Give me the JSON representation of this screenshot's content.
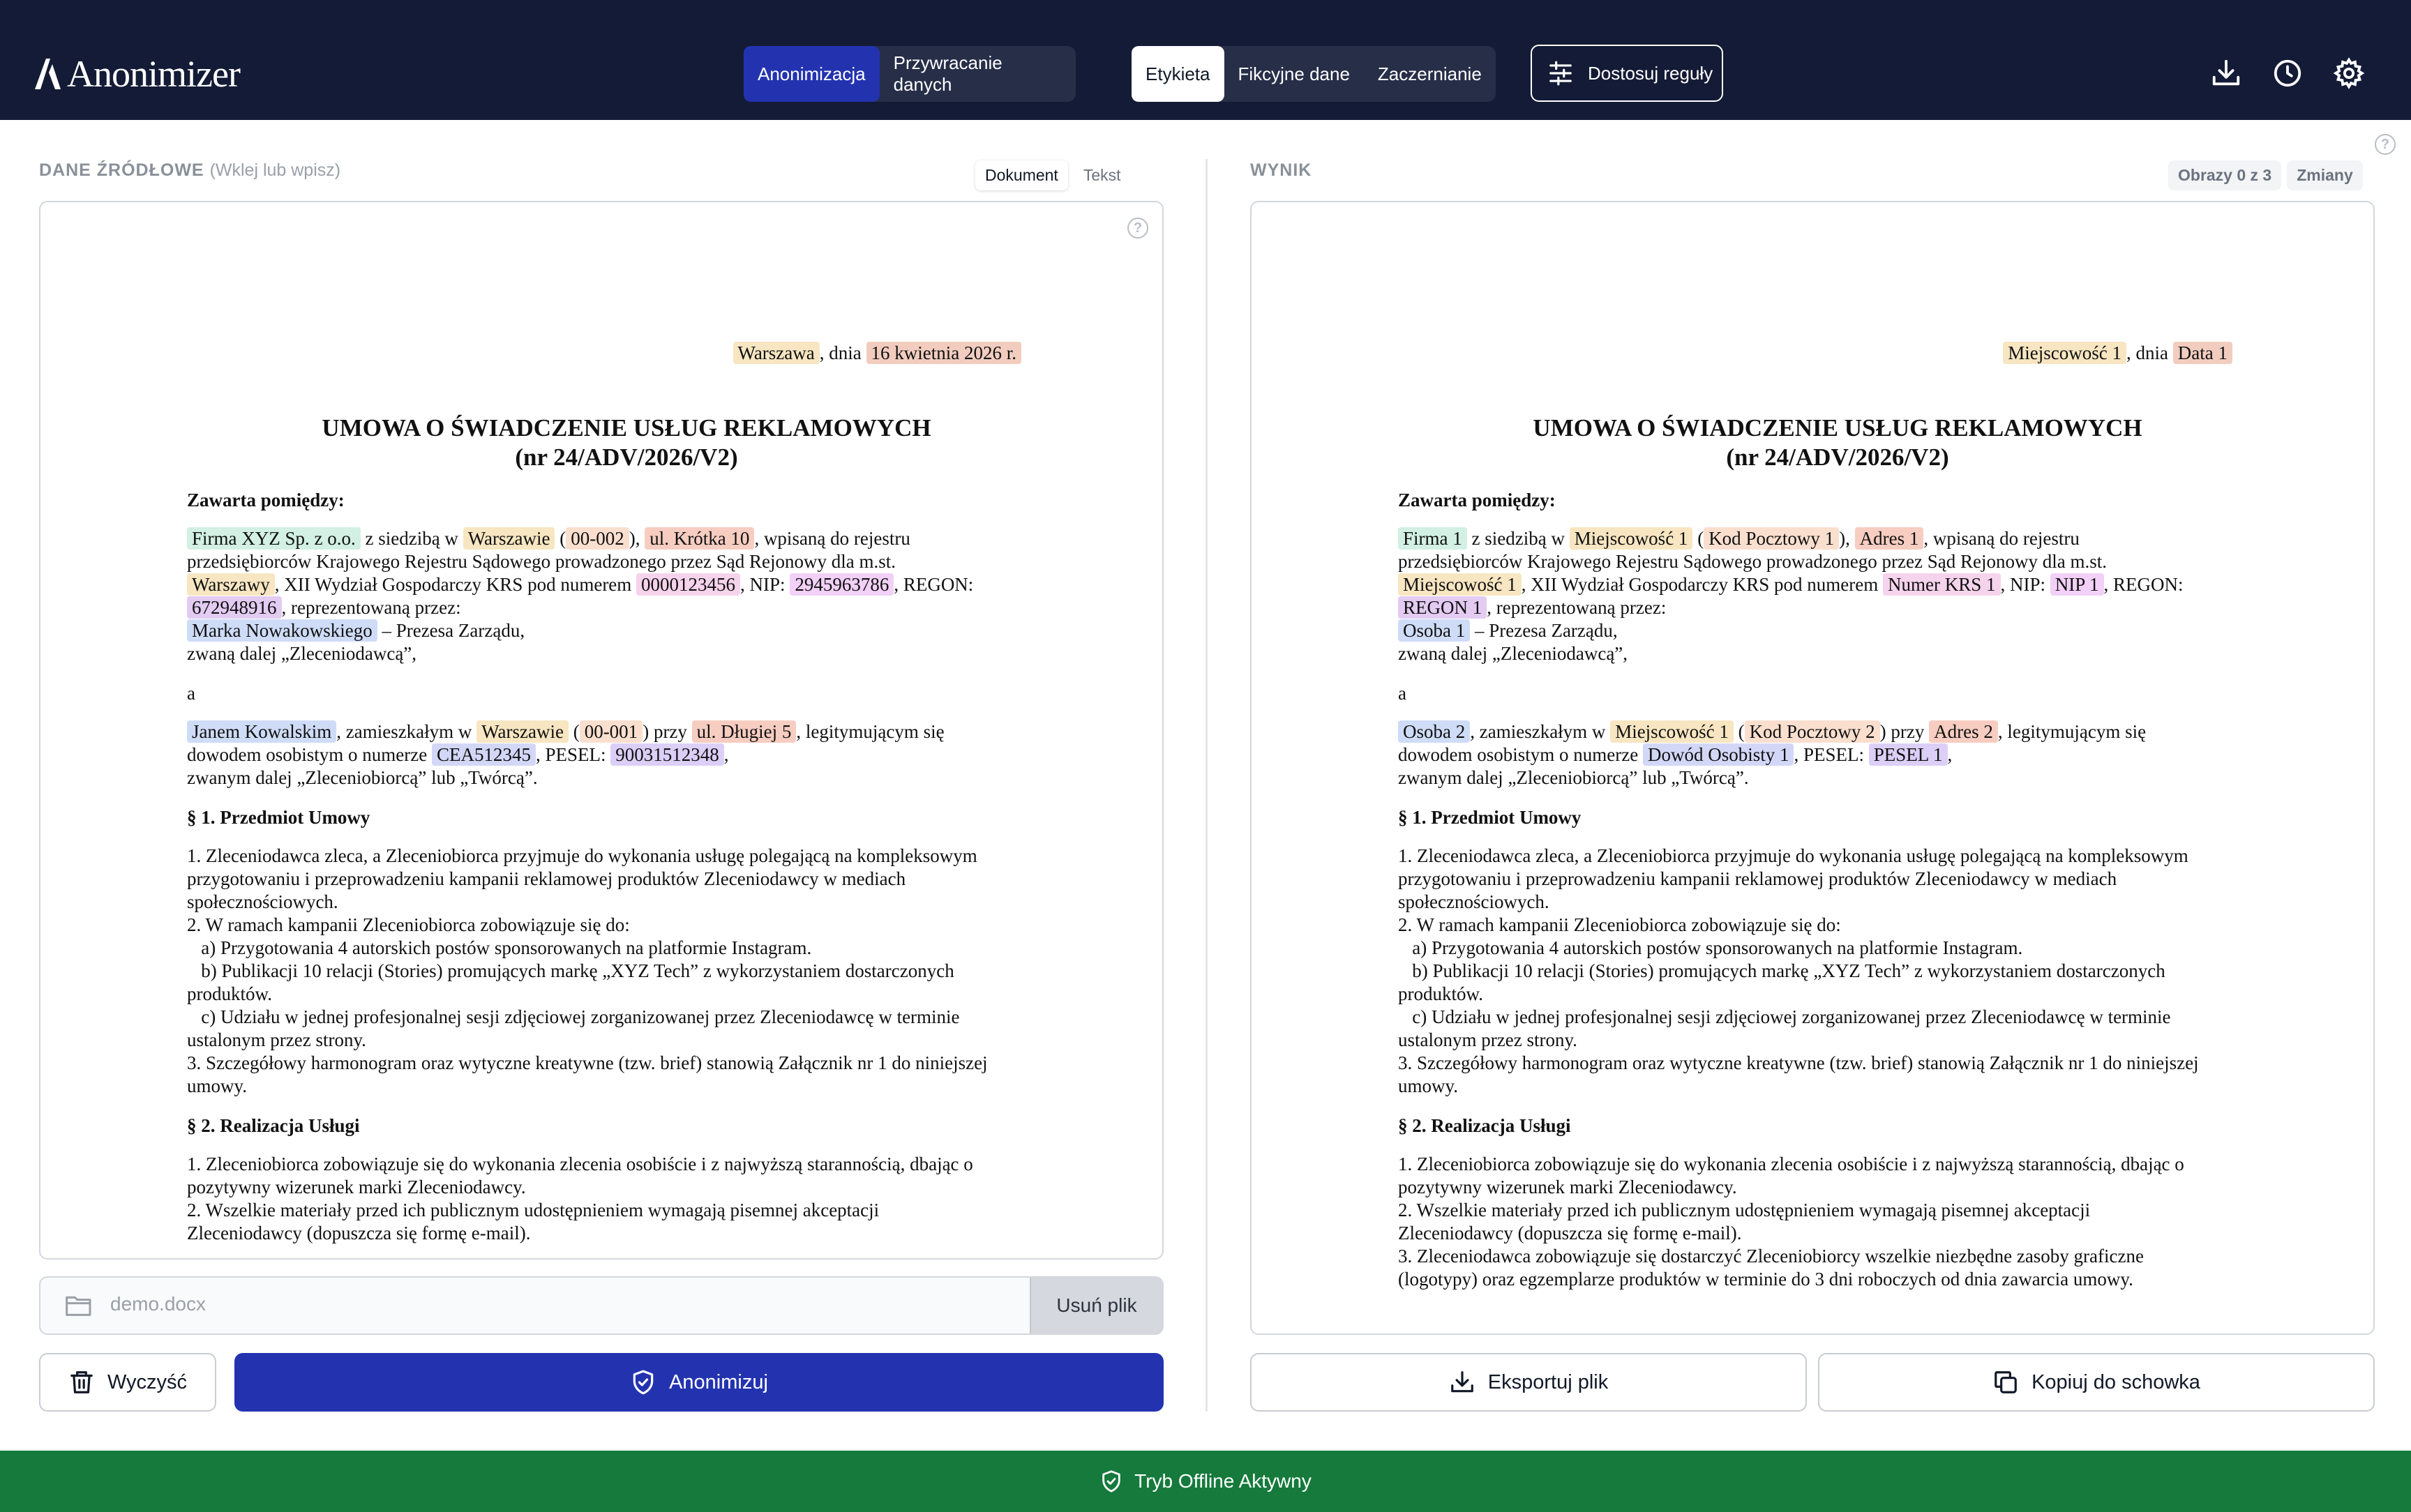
{
  "app": {
    "title": "Anonimizer"
  },
  "mode_tabs": [
    "Anonimizacja",
    "Przywracanie danych"
  ],
  "replace_tabs": [
    "Etykieta",
    "Fikcyjne dane",
    "Zaczernianie"
  ],
  "rules_button": "Dostosuj reguły",
  "source_panel": {
    "label": "DANE ŹRÓDŁOWE",
    "hint": "(Wklej lub wpisz)",
    "view_tabs": [
      "Dokument",
      "Tekst"
    ],
    "help": "?",
    "file_name": "demo.docx",
    "remove_label": "Usuń plik",
    "clear_label": "Wyczyść",
    "anonymize_label": "Anonimizuj"
  },
  "result_panel": {
    "label": "WYNIK",
    "images_badge": "Obrazy 0 z 3",
    "changes_label": "Zmiany",
    "export_label": "Eksportuj plik",
    "copy_label": "Kopiuj do schowka"
  },
  "footer": {
    "status": "Tryb Offline Aktywny"
  },
  "colors": {
    "header_bg": "#141b36",
    "accent": "#2333b0",
    "footer_bg": "#157a3b"
  },
  "source_doc": {
    "city_1": "Warszawa",
    "date_sep": ", dnia",
    "date": "16 kwietnia 2026 r.",
    "title_1": "UMOWA O ŚWIADCZENIE USŁUG REKLAMOWYCH",
    "title_2": "(nr 24/ADV/2026/V2)",
    "parties": "Zawarta pomiędzy:",
    "company": "Firma XYZ Sp. z o.o.",
    "t1": " z siedzibą w ",
    "city_2": "Warszawie",
    "zip_1": "00-002",
    "address_1": "ul. Krótka 10",
    "t2": ", wpisaną do rejestru",
    "t3": "przedsiębiorców Krajowego Rejestru Sądowego prowadzonego przez Sąd Rejonowy dla m.st.",
    "city_3": "Warszawy",
    "t4": ", XII Wydział Gospodarczy KRS pod numerem ",
    "krs": "0000123456",
    "t5": ", NIP: ",
    "nip": "2945963786",
    "t6": ", REGON:",
    "regon": "672948916",
    "t7": ", reprezentowaną przez:",
    "person_1": "Marka Nowakowskiego",
    "t8": " – Prezesa Zarządu,",
    "t9": "zwaną dalej „Zleceniodawcą”,",
    "conj": "a",
    "person_2": "Janem Kowalskim",
    "t10": ", zamieszkałym w ",
    "city_4": "Warszawie",
    "zip_2": "00-001",
    "t11": " przy ",
    "address_2": "ul. Długiej 5",
    "t12": ", legitymującym się",
    "t13": "dowodem osobistym o numerze ",
    "id_card": "CEA512345",
    "t14": ", PESEL: ",
    "pesel": "90031512348",
    "t15": ",",
    "t16": "zwanym dalej „Zleceniobiorcą” lub „Twórcą”.",
    "s1_title": "§ 1. Przedmiot Umowy",
    "s1_p1a": "1. Zleceniodawca zleca, a Zleceniobiorca przyjmuje do wykonania usługę polegającą na kompleksowym",
    "s1_p1b": "przygotowaniu i przeprowadzeniu kampanii reklamowej produktów Zleceniodawcy w mediach",
    "s1_p1c": "społecznościowych.",
    "s1_p2": "2. W ramach kampanii Zleceniobiorca zobowiązuje się do:",
    "s1_p2a": "a) Przygotowania 4 autorskich postów sponsorowanych na platformie Instagram.",
    "s1_p2b1": "b) Publikacji 10 relacji (Stories) promujących markę „XYZ Tech” z wykorzystaniem dostarczonych",
    "s1_p2b2": "produktów.",
    "s1_p2c1": "c) Udziału w jednej profesjonalnej sesji zdjęciowej zorganizowanej przez Zleceniodawcę w terminie",
    "s1_p2c2": "ustalonym przez strony.",
    "s1_p3a": "3. Szczegółowy harmonogram oraz wytyczne kreatywne (tzw. brief) stanowią Załącznik nr 1 do niniejszej",
    "s1_p3b": "umowy.",
    "s2_title": "§ 2. Realizacja Usługi",
    "s2_p1a": "1. Zleceniobiorca zobowiązuje się do wykonania zlecenia osobiście i z najwyższą starannością, dbając o",
    "s2_p1b": "pozytywny wizerunek marki Zleceniodawcy.",
    "s2_p2a": "2. Wszelkie materiały przed ich publicznym udostępnieniem wymagają pisemnej akceptacji",
    "s2_p2b": "Zleceniodawcy (dopuszcza się formę e-mail).",
    "s2_p3a": "3. Zleceniodawca zobowiązuje się dostarczyć Zleceniobiorcy wszelkie niezbędne zasoby graficzne",
    "s2_p3b": "(logotypy) oraz egzemplarze produktów w terminie do 3 dni roboczych od dnia zawarcia umowy."
  },
  "result_doc": {
    "city_1": "Miejscowość 1",
    "date": "Data 1",
    "company": "Firma 1",
    "city_2": "Miejscowość 1",
    "zip_1": "Kod Pocztowy 1",
    "address_1": "Adres 1",
    "city_3": "Miejscowość 1",
    "krs": "Numer KRS 1",
    "nip": "NIP 1",
    "regon": "REGON 1",
    "person_1": "Osoba 1",
    "person_2": "Osoba 2",
    "city_4": "Miejscowość 1",
    "zip_2": "Kod Pocztowy 2",
    "address_2": "Adres 2",
    "id_card": "Dowód Osobisty 1",
    "pesel": "PESEL 1"
  }
}
